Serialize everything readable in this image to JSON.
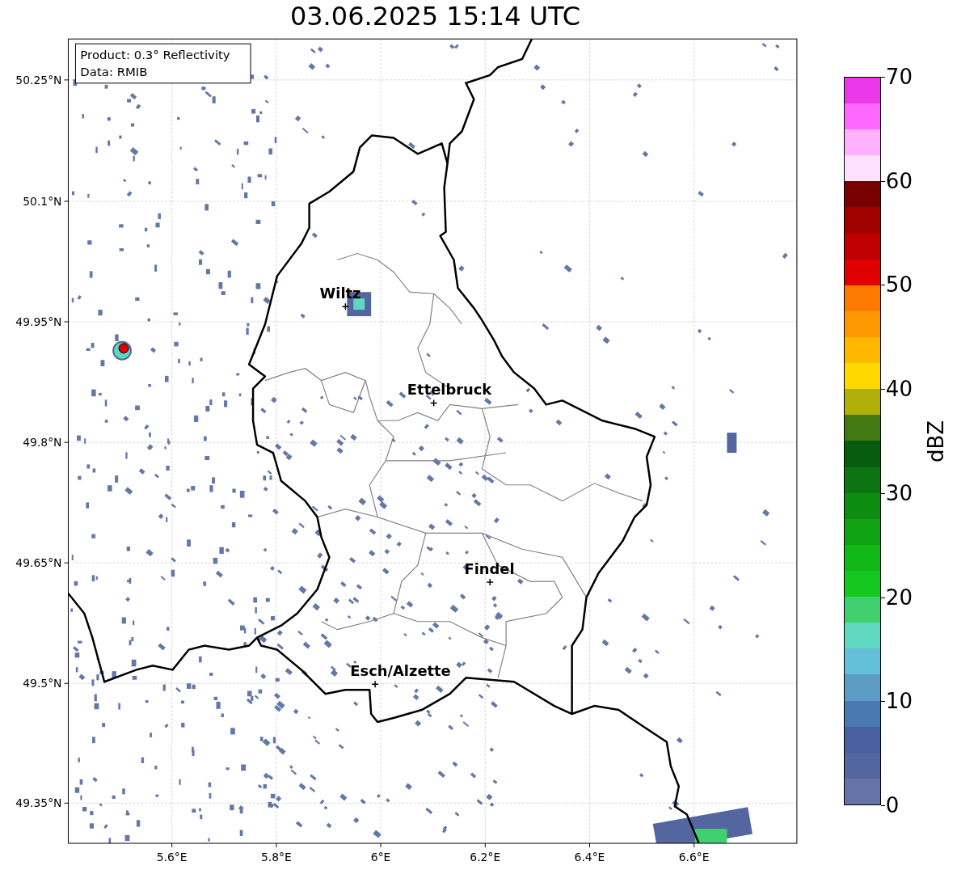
{
  "title": "03.06.2025 15:14 UTC",
  "info_box": [
    "Product: 0.3° Reflectivity",
    "Data: RMIB"
  ],
  "y_ticks": [
    "50.25°N",
    "50.1°N",
    "49.95°N",
    "49.8°N",
    "49.65°N",
    "49.5°N",
    "49.35°N"
  ],
  "x_ticks": [
    "5.6°E",
    "5.8°E",
    "6°E",
    "6.2°E",
    "6.4°E",
    "6.6°E"
  ],
  "cities": [
    {
      "name": "Wiltz"
    },
    {
      "name": "Ettelbruck"
    },
    {
      "name": "Findel"
    },
    {
      "name": "Esch/Alzette"
    }
  ],
  "colorbar": {
    "label": "dBZ",
    "ticks": [
      "70",
      "60",
      "50",
      "40",
      "30",
      "20",
      "10",
      "0"
    ],
    "segments": [
      {
        "color": "#6474a8"
      },
      {
        "color": "#5466a0"
      },
      {
        "color": "#4860a0"
      },
      {
        "color": "#4a78b0"
      },
      {
        "color": "#5a9cc4"
      },
      {
        "color": "#64c0d8"
      },
      {
        "color": "#60d8c0"
      },
      {
        "color": "#40d070"
      },
      {
        "color": "#14c820"
      },
      {
        "color": "#12b818"
      },
      {
        "color": "#10a414"
      },
      {
        "color": "#0e8c12"
      },
      {
        "color": "#0c7412"
      },
      {
        "color": "#085c10"
      },
      {
        "color": "#447810"
      },
      {
        "color": "#b0b008"
      },
      {
        "color": "#ffd800"
      },
      {
        "color": "#ffb800"
      },
      {
        "color": "#ff9800"
      },
      {
        "color": "#ff7800"
      },
      {
        "color": "#e00000"
      },
      {
        "color": "#c00000"
      },
      {
        "color": "#a00000"
      },
      {
        "color": "#780000"
      },
      {
        "color": "#ffe0ff"
      },
      {
        "color": "#ffb0ff"
      },
      {
        "color": "#ff68ff"
      },
      {
        "color": "#e838e8"
      }
    ]
  }
}
